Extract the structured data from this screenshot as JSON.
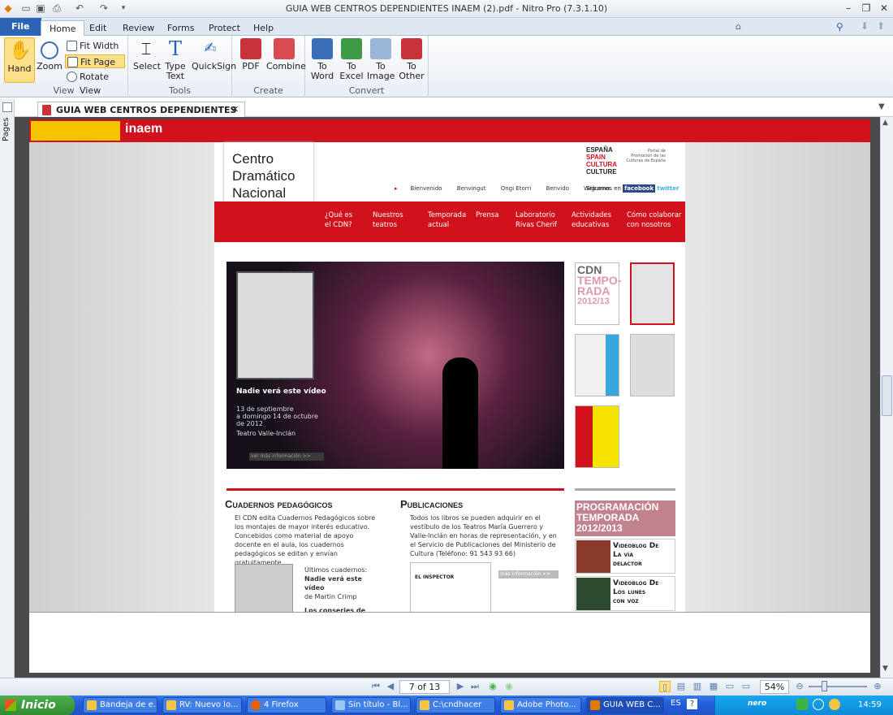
{
  "window": {
    "title": "GUIA WEB CENTROS DEPENDIENTES INAEM (2).pdf - Nitro Pro (7.3.1.10)"
  },
  "ribbon_tabs": [
    "File",
    "Home",
    "Edit",
    "Review",
    "Forms",
    "Protect",
    "Help"
  ],
  "search": {
    "placeholder": "Find"
  },
  "ribbon": {
    "view": {
      "label": "View",
      "hand": "Hand",
      "zoom": "Zoom",
      "fit_width": "Fit Width",
      "fit_page": "Fit Page",
      "rotate_view": "Rotate View"
    },
    "tools": {
      "label": "Tools",
      "select": "Select",
      "type_text_1": "Type",
      "type_text_2": "Text",
      "quicksign": "QuickSign"
    },
    "create": {
      "label": "Create",
      "pdf": "PDF",
      "combine": "Combine"
    },
    "convert": {
      "label": "Convert",
      "to": "To",
      "word": "Word",
      "excel": "Excel",
      "image": "Image",
      "other": "Other"
    }
  },
  "side_panel": {
    "pages_label": "Pages"
  },
  "document_tab": {
    "label": "GUIA WEB CENTROS DEPENDIENTES INA..."
  },
  "pdf_content": {
    "inaem_brand": "inaem",
    "site_name": [
      "Centro",
      "Dramático",
      "Nacional"
    ],
    "portal_brand": [
      "ESPAÑA",
      "SPAIN",
      "CULTURA",
      "CULTURE"
    ],
    "portal_text": "Portal de Promoción de las Culturas de España",
    "languages": [
      "Bienvenido",
      "Benvingut",
      "Ongi Etorri",
      "Benvido",
      "Welcome"
    ],
    "social_label": "Síguenos en",
    "facebook": "facebook",
    "twitter": "twitter",
    "nav": [
      [
        "¿Qué es",
        "el CDN?"
      ],
      [
        "Nuestros",
        "teatros"
      ],
      [
        "Temporada",
        "actual"
      ],
      [
        "Prensa",
        ""
      ],
      [
        "Laboratorio",
        "Rivas Cherif"
      ],
      [
        "Actividades",
        "educativas"
      ],
      [
        "Cómo colaborar",
        "con nosotros"
      ]
    ],
    "hero": {
      "title": "Nadie verá este vídeo",
      "dates": [
        "13 de septiembre",
        "a domingo 14 de octubre",
        "de 2012"
      ],
      "venue": "Teatro Valle-Inclán",
      "more": "ver más información >>"
    },
    "cdn_thumb": [
      "CDN",
      "TEMPO-",
      "RADA",
      "2012/13"
    ],
    "cuadernos": {
      "heading": "Cuadernos pedagógicos",
      "body": "El CDN edita Cuadernos Pedagógicos sobre los montajes de mayor interés educativo. Concebidos como material de apoyo docente en el aula, los cuadernos pedagógicos se editan y envían gratuitamente.",
      "latest_label": "Últimos cuadernos:",
      "latest_1": "Nadie verá este vídeo",
      "latest_1_author": "de Martin Crimp",
      "latest_2": "Los conserjes de San Felipe"
    },
    "publicaciones": {
      "heading": "Publicaciones",
      "body": "Todos los libros se pueden adquirir en el vestíbulo de los Teatros María Guerrero y Valle-Inclán en horas de representación, y en el Servicio de Publicaciones del Ministerio de Cultura (Teléfono: 91 543 93 66)",
      "more": "más información >>",
      "book_title": "EL INSPECTOR"
    },
    "programacion": [
      "PROGRAMACIÓN",
      "TEMPORADA",
      "2012/2013"
    ],
    "videoblog_1": [
      "Videoblog De",
      "La vía",
      "delactor"
    ],
    "videoblog_2": [
      "Videoblog De",
      "Los lunes",
      "con voz"
    ]
  },
  "status_bar": {
    "page_input": "7 of 13",
    "zoom": "54%"
  },
  "taskbar": {
    "start": "Inicio",
    "tasks": [
      "Bandeja de e...",
      "RV: Nuevo lo...",
      "4 Firefox",
      "Sin título - Bl...",
      "C:\\cndhacer",
      "Adobe Photo...",
      "GUIA WEB C..."
    ],
    "lang": "ES",
    "nero": "nero",
    "clock": "14:59"
  },
  "colors": {
    "accent": "#d1111b",
    "ribbon_blue": "#2c63b5"
  }
}
